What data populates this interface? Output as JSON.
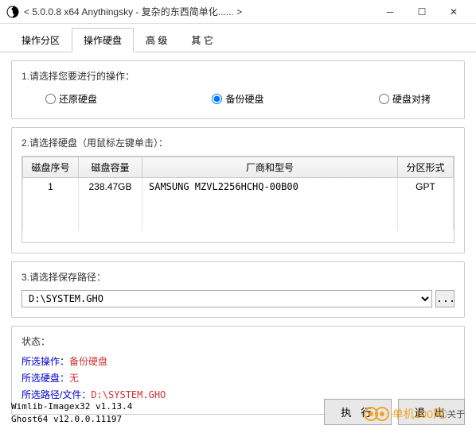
{
  "window": {
    "title": "< 5.0.0.8 x64 Anythingsky - 复杂的东西简单化...... >"
  },
  "tabs": [
    "操作分区",
    "操作硬盘",
    "高 级",
    "其 它"
  ],
  "activeTab": 1,
  "section1": {
    "label": "1.请选择您要进行的操作：",
    "options": [
      "还原硬盘",
      "备份硬盘",
      "硬盘对拷"
    ],
    "selected": 1
  },
  "section2": {
    "label": "2.请选择硬盘（用鼠标左键单击）：",
    "headers": [
      "磁盘序号",
      "磁盘容量",
      "厂商和型号",
      "分区形式"
    ],
    "rows": [
      {
        "num": "1",
        "cap": "238.47GB",
        "vendor": "SAMSUNG MZVL2256HCHQ-00B00",
        "ptype": "GPT"
      }
    ]
  },
  "section3": {
    "label": "3.请选择保存路径：",
    "path": "D:\\SYSTEM.GHO",
    "browse": "..."
  },
  "status": {
    "label": "状态：",
    "opLabel": "所选操作：",
    "opVal": "备份硬盘",
    "diskLabel": "所选硬盘：",
    "diskVal": "无",
    "pathLabel": "所选路径/文件：",
    "pathVal": "D:\\SYSTEM.GHO"
  },
  "version": {
    "l1": "Wimlib-Imagex32 v1.13.4",
    "l2": "Ghost64 v12.0.0.11197"
  },
  "buttons": {
    "exec": "执 行",
    "exit": "退 出"
  },
  "about": "①关于",
  "watermark": "单机100网"
}
